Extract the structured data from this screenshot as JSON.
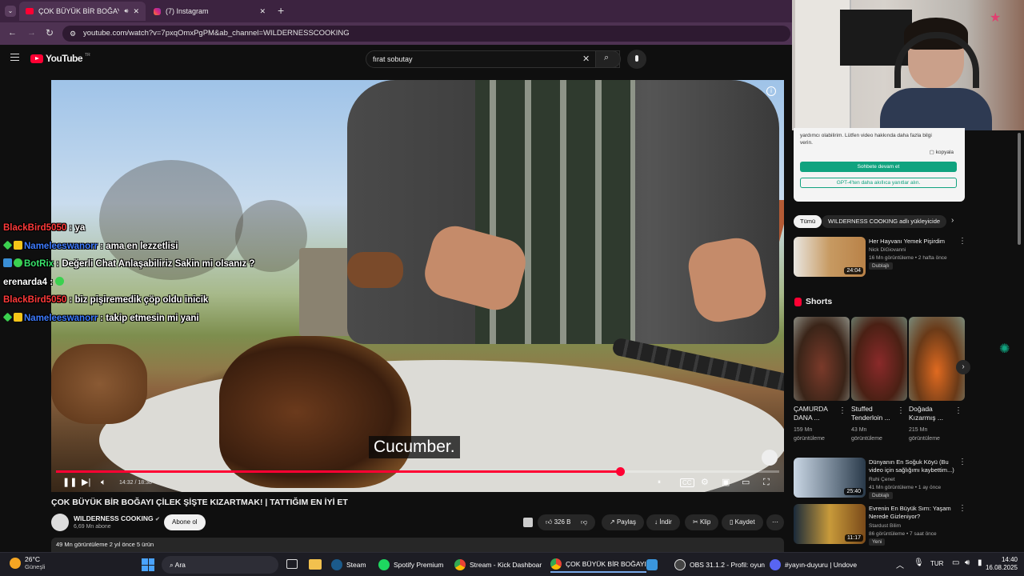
{
  "browser": {
    "tabs": [
      {
        "title": "ÇOK BÜYÜK BİR BOĞAYI Çİ",
        "active": true
      },
      {
        "title": "(7) Instagram",
        "active": false
      }
    ],
    "new_tab": "+",
    "url": "youtube.com/watch?v=7pxqOmxPgPM&ab_channel=WILDERNESSCOOKING"
  },
  "youtube": {
    "logo": "YouTube",
    "logo_country": "TR",
    "search_value": "fırat sobutay"
  },
  "video": {
    "subtitle": "Cucumber.",
    "time": "14:32 / 18:38",
    "progress": 0.78,
    "title": "ÇOK BÜYÜK BİR BOĞAYI ÇİLEK ŞİŞTE KIZARTMAK! | TATTIĞIM EN İYİ ET",
    "channel": "WILDERNESS COOKING",
    "subscribers": "6,69 Mn abone",
    "subscribe": "Abone ol",
    "likes": "326 B",
    "share": "Paylaş",
    "download": "İndir",
    "clip": "Klip",
    "save": "Kaydet",
    "more": "⋯",
    "desc_meta": "49 Mn görüntüleme  2 yıl önce  5 ürün"
  },
  "chat": [
    {
      "user": "BlackBird5050",
      "msg": ": ya",
      "color": "#ff3a3a",
      "badge": ""
    },
    {
      "user": "Nameleeswanorr",
      "msg": ": ama en lezzetlisi",
      "color": "#3d7bff",
      "badge": "gold"
    },
    {
      "user": "BotRix",
      "msg": ": Değerli Chat Anlaşabiliriz Sakin mi olsanız ?",
      "color": "#39e36b",
      "badge": "bot"
    },
    {
      "user": "erenarda4",
      "msg": ":",
      "color": "#ffffff",
      "badge": ""
    },
    {
      "user": "BlackBird5050",
      "msg": ": biz pişiremedik çöp oldu inicik",
      "color": "#ff3a3a",
      "badge": ""
    },
    {
      "user": "Nameleeswanorr",
      "msg": ": takip etmesin mi yani",
      "color": "#3d7bff",
      "badge": "gold"
    }
  ],
  "gpt_panel": {
    "text_line1": "yardımcı olabilirim. Lütfen video hakkında daha fazla bilgi",
    "text_line2": "verin.",
    "copy": "kopyala",
    "continue_btn": "Sohbete devam et",
    "upgrade_btn": "GPT-4'ten daha akıllıca yanıtlar alın."
  },
  "filters": {
    "all": "Tümü",
    "channel_chip": "WILDERNESS COOKING adlı yükleyicide"
  },
  "recommended": [
    {
      "title": "Her Hayvanı Yemek Pişirdim",
      "channel": "Nick DiGiovanni",
      "meta": "16 Mn görüntüleme • 2 hafta önce",
      "tag": "Dublajlı",
      "duration": "24:04"
    },
    {
      "title": "Dünyanın En Soğuk Köyü (Bu video için sağlığımı kaybettim...)",
      "channel": "Ruhi Çenet",
      "meta": "41 Mn görüntüleme • 1 ay önce",
      "tag": "Dublajlı",
      "duration": "25:40"
    },
    {
      "title": "Evrenin En Büyük Sırrı: Yaşam Nerede Gizleniyor?",
      "channel": "Stardust Bilim",
      "meta": "86 görüntüleme • 7 saat önce",
      "tag": "Yeni",
      "duration": "11:17"
    }
  ],
  "shorts": {
    "heading": "Shorts",
    "items": [
      {
        "title": "ÇAMURDA DANA ...",
        "views": "159 Mn görüntüleme"
      },
      {
        "title": "Stuffed Tenderloin ...",
        "views": "43 Mn görüntüleme"
      },
      {
        "title": "Doğada Kızarmış ...",
        "views": "215 Mn görüntüleme"
      }
    ]
  },
  "taskbar": {
    "weather_temp": "26°C",
    "weather_desc": "Güneşli",
    "search": "Ara",
    "apps": [
      {
        "label": "Steam",
        "color": "#1b5a8a"
      },
      {
        "label": "Spotify Premium",
        "color": "#1ed760"
      },
      {
        "label": "Stream - Kick Dashboar",
        "color": "#e0e0e0"
      },
      {
        "label": "ÇOK BÜYÜK BİR BOĞAYI",
        "color": "#e0e0e0"
      },
      {
        "label": "OBS 31.1.2 - Profil: oyun",
        "color": "#444"
      },
      {
        "label": "#yayın-duyuru | Undove",
        "color": "#5865f2"
      }
    ],
    "lang": "TUR",
    "time": "14:40",
    "date": "16.08.2025"
  }
}
